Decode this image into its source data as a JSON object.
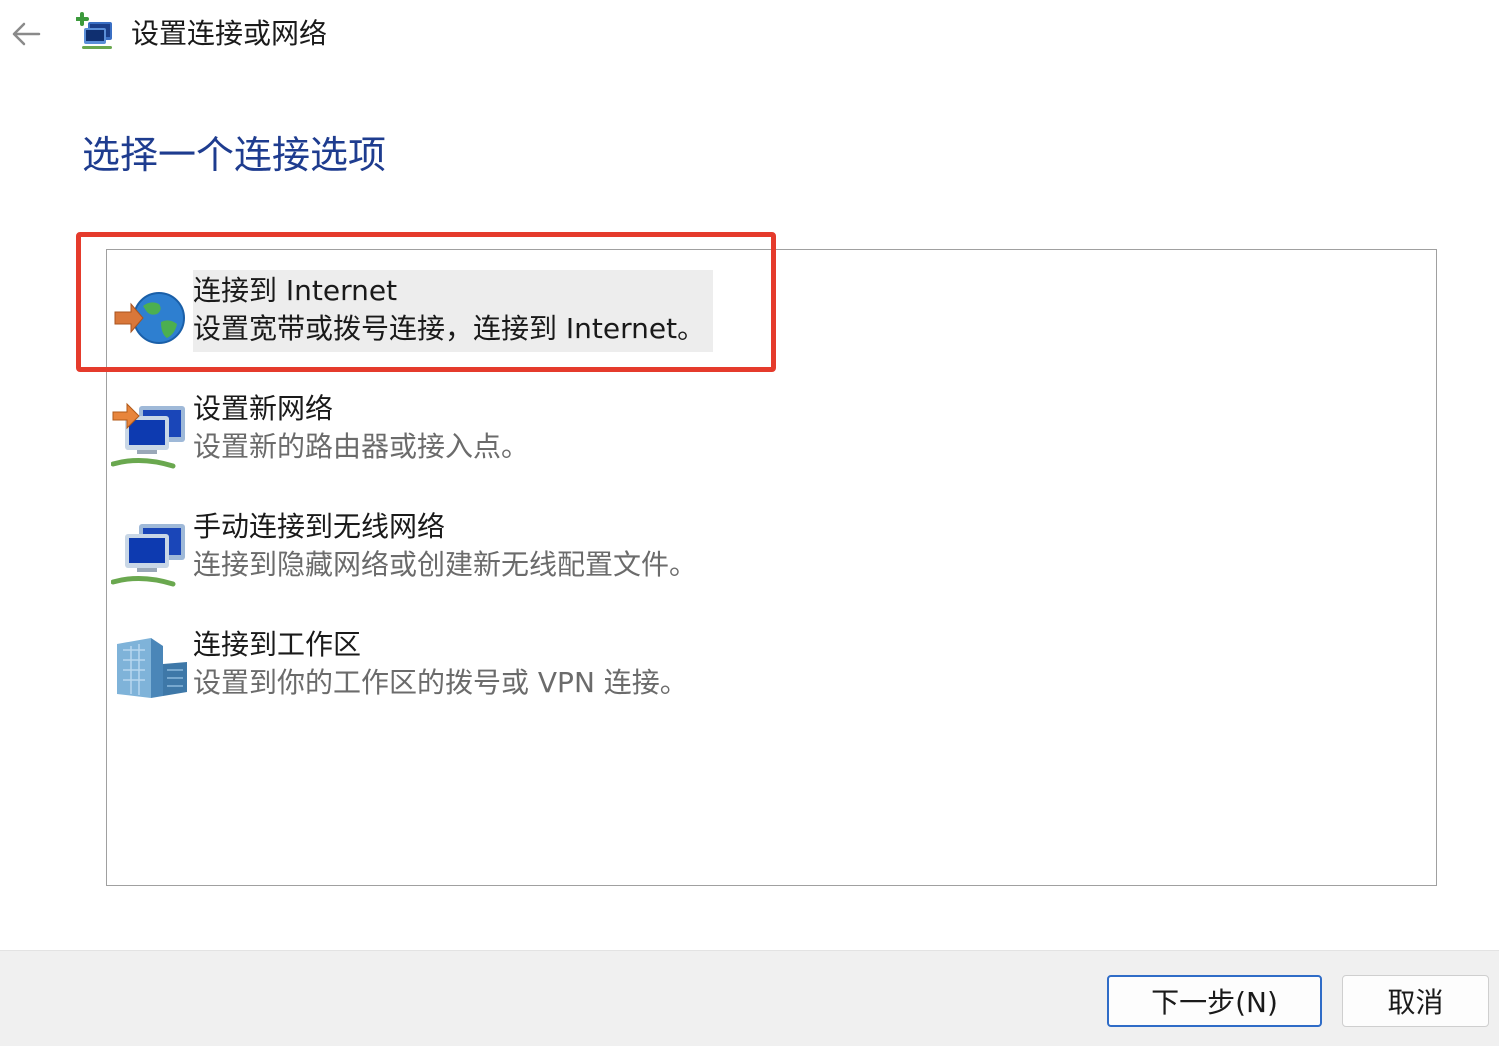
{
  "window": {
    "title": "设置连接或网络",
    "back_icon": "back-arrow-icon",
    "title_icon": "network-setup-icon"
  },
  "page": {
    "heading": "选择一个连接选项"
  },
  "options": [
    {
      "icon": "globe-internet-icon",
      "title": "连接到 Internet",
      "description": "设置宽带或拨号连接，连接到 Internet。",
      "selected": true
    },
    {
      "icon": "new-network-icon",
      "title": "设置新网络",
      "description": "设置新的路由器或接入点。",
      "selected": false
    },
    {
      "icon": "wireless-network-icon",
      "title": "手动连接到无线网络",
      "description": "连接到隐藏网络或创建新无线配置文件。",
      "selected": false
    },
    {
      "icon": "workplace-building-icon",
      "title": "连接到工作区",
      "description": "设置到你的工作区的拨号或 VPN 连接。",
      "selected": false
    }
  ],
  "footer": {
    "next_label": "下一步(N)",
    "cancel_label": "取消"
  },
  "colors": {
    "heading": "#1e3c8f",
    "highlight_border": "#e53b2c",
    "primary_button_border": "#2f6cc7",
    "selected_background": "#ededed",
    "footer_background": "#f0f0f0"
  }
}
